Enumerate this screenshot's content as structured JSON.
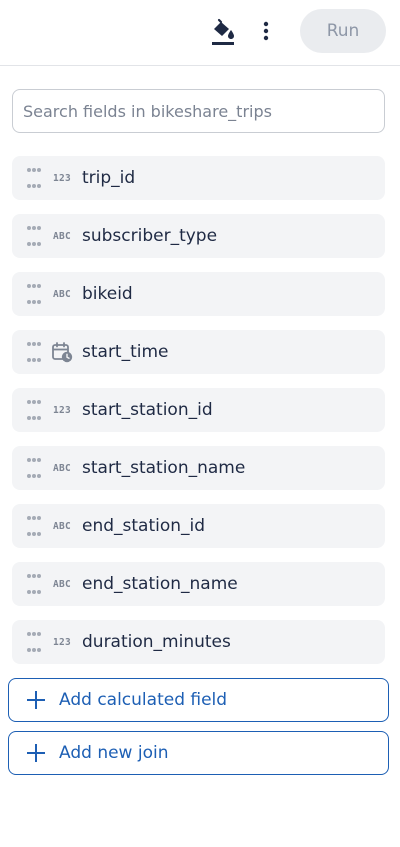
{
  "toolbar": {
    "paint_icon": "format-color-fill-icon",
    "more_icon": "more-vertical-icon",
    "run_label": "Run"
  },
  "search": {
    "placeholder": "Search fields in bikeshare_trips",
    "value": ""
  },
  "fields": [
    {
      "name": "trip_id",
      "type": "123"
    },
    {
      "name": "subscriber_type",
      "type": "ABC"
    },
    {
      "name": "bikeid",
      "type": "ABC"
    },
    {
      "name": "start_time",
      "type": "calendar-clock-icon"
    },
    {
      "name": "start_station_id",
      "type": "123"
    },
    {
      "name": "start_station_name",
      "type": "ABC"
    },
    {
      "name": "end_station_id",
      "type": "ABC"
    },
    {
      "name": "end_station_name",
      "type": "ABC"
    },
    {
      "name": "duration_minutes",
      "type": "123"
    }
  ],
  "actions": {
    "add_calculated_field": "Add calculated field",
    "add_new_join": "Add new join"
  },
  "colors": {
    "primary": "#1d5fb4",
    "text": "#1f2a44",
    "row_bg": "#f3f4f6",
    "run_bg": "#eaecef"
  }
}
